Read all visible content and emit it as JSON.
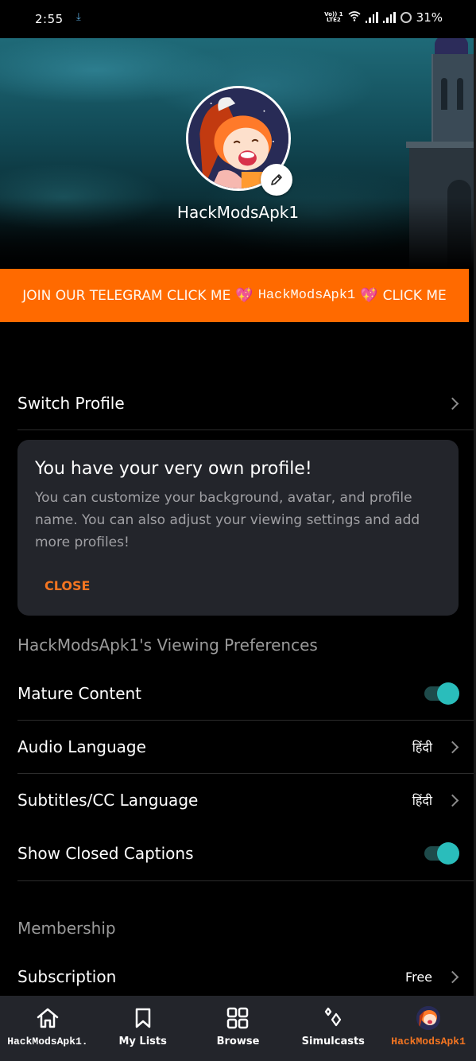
{
  "status_bar": {
    "time": "2:55",
    "download_icon": "download-arrow-icon",
    "network_label_top": "Vo)) 1",
    "network_label_bottom": "LTE2",
    "battery": "31%"
  },
  "profile": {
    "name": "HackModsApk1",
    "edit_icon": "pencil-icon"
  },
  "banner": {
    "part1": "JOIN OUR TELEGRAM CLICK ME",
    "heart1": "💖",
    "part2": "HackModsApk1",
    "heart2": "💖",
    "part3": "CLICK ME",
    "background": "#ff6a00"
  },
  "switch_profile": {
    "label": "Switch Profile"
  },
  "info_card": {
    "title": "You have your very own profile!",
    "body": "You can customize your background, avatar, and profile name. You can also adjust your viewing settings and add more profiles!",
    "close_label": "CLOSE"
  },
  "viewing_preferences": {
    "heading": "HackModsApk1's Viewing Preferences",
    "items": [
      {
        "label": "Mature Content",
        "type": "toggle",
        "enabled": true
      },
      {
        "label": "Audio Language",
        "type": "link",
        "value": "हिंदी"
      },
      {
        "label": "Subtitles/CC Language",
        "type": "link",
        "value": "हिंदी"
      },
      {
        "label": "Show Closed Captions",
        "type": "toggle",
        "enabled": true
      }
    ]
  },
  "membership": {
    "heading": "Membership",
    "items": [
      {
        "label": "Subscription",
        "value": "Free"
      }
    ]
  },
  "bottom_nav": {
    "items": [
      {
        "label": "HackModsApk1.",
        "icon": "home-icon",
        "active": false
      },
      {
        "label": "My Lists",
        "icon": "bookmark-icon",
        "active": false
      },
      {
        "label": "Browse",
        "icon": "grid-icon",
        "active": false
      },
      {
        "label": "Simulcasts",
        "icon": "sparkle-icon",
        "active": false
      },
      {
        "label": "HackModsApk1",
        "icon": "profile-avatar-icon",
        "active": true
      }
    ]
  },
  "colors": {
    "accent": "#f47521",
    "toggle_on": "#2abdbb",
    "card_bg": "#23252b",
    "nav_bg": "#23252b"
  }
}
